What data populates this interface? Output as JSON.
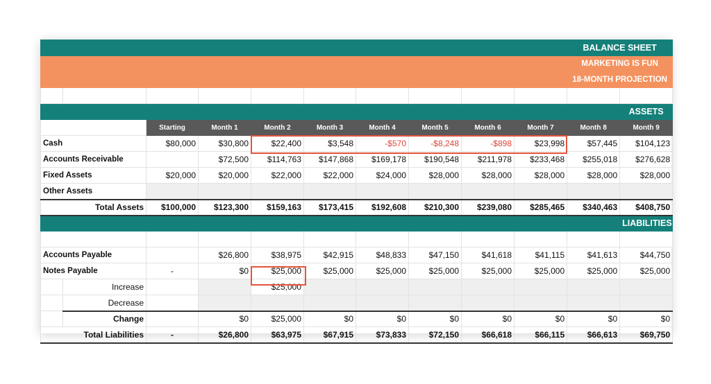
{
  "header": {
    "title": "BALANCE SHEET",
    "company": "MARKETING IS FUN",
    "projection": "18-MONTH PROJECTION"
  },
  "sections": {
    "assets": "ASSETS",
    "liabilities": "LIABILITIES"
  },
  "columns": [
    "Starting",
    "Month 1",
    "Month 2",
    "Month 3",
    "Month 4",
    "Month 5",
    "Month 6",
    "Month 7",
    "Month 8",
    "Month 9"
  ],
  "assets": {
    "cash": {
      "label": "Cash",
      "values": [
        "$80,000",
        "$30,800",
        "$22,400",
        "$3,548",
        "-$570",
        "-$8,248",
        "-$898",
        "$23,998",
        "$57,445",
        "$104,123"
      ]
    },
    "accounts_receivable": {
      "label": "Accounts Receivable",
      "values": [
        "",
        "$72,500",
        "$114,763",
        "$147,868",
        "$169,178",
        "$190,548",
        "$211,978",
        "$233,468",
        "$255,018",
        "$276,628"
      ]
    },
    "fixed_assets": {
      "label": "Fixed Assets",
      "values": [
        "$20,000",
        "$20,000",
        "$22,000",
        "$22,000",
        "$24,000",
        "$28,000",
        "$28,000",
        "$28,000",
        "$28,000",
        "$28,000"
      ]
    },
    "other_assets": {
      "label": "Other Assets",
      "values": [
        "",
        "",
        "",
        "",
        "",
        "",
        "",
        "",
        "",
        ""
      ]
    },
    "total": {
      "label": "Total Assets",
      "values": [
        "$100,000",
        "$123,300",
        "$159,163",
        "$173,415",
        "$192,608",
        "$210,300",
        "$239,080",
        "$285,465",
        "$340,463",
        "$408,750"
      ]
    }
  },
  "liabilities": {
    "accounts_payable": {
      "label": "Accounts Payable",
      "values": [
        "",
        "$26,800",
        "$38,975",
        "$42,915",
        "$48,833",
        "$47,150",
        "$41,618",
        "$41,115",
        "$41,613",
        "$44,750"
      ]
    },
    "notes_payable": {
      "label": "Notes Payable",
      "values": [
        "-",
        "$0",
        "$25,000",
        "$25,000",
        "$25,000",
        "$25,000",
        "$25,000",
        "$25,000",
        "$25,000",
        "$25,000"
      ]
    },
    "increase": {
      "label": "Increase",
      "values": [
        "",
        "",
        "$25,000",
        "",
        "",
        "",
        "",
        "",
        "",
        ""
      ]
    },
    "decrease": {
      "label": "Decrease",
      "values": [
        "",
        "",
        "",
        "",
        "",
        "",
        "",
        "",
        "",
        ""
      ]
    },
    "change": {
      "label": "Change",
      "values": [
        "",
        "$0",
        "$25,000",
        "$0",
        "$0",
        "$0",
        "$0",
        "$0",
        "$0",
        "$0"
      ]
    },
    "total": {
      "label": "Total Liabilities",
      "values": [
        "-",
        "$26,800",
        "$63,975",
        "$67,915",
        "$73,833",
        "$72,150",
        "$66,618",
        "$66,115",
        "$66,613",
        "$69,750"
      ]
    }
  },
  "colors": {
    "teal": "#15807a",
    "orange": "#f4925f",
    "header_grey": "#595959",
    "negative": "#d9463a",
    "highlight": "#e3533d"
  }
}
